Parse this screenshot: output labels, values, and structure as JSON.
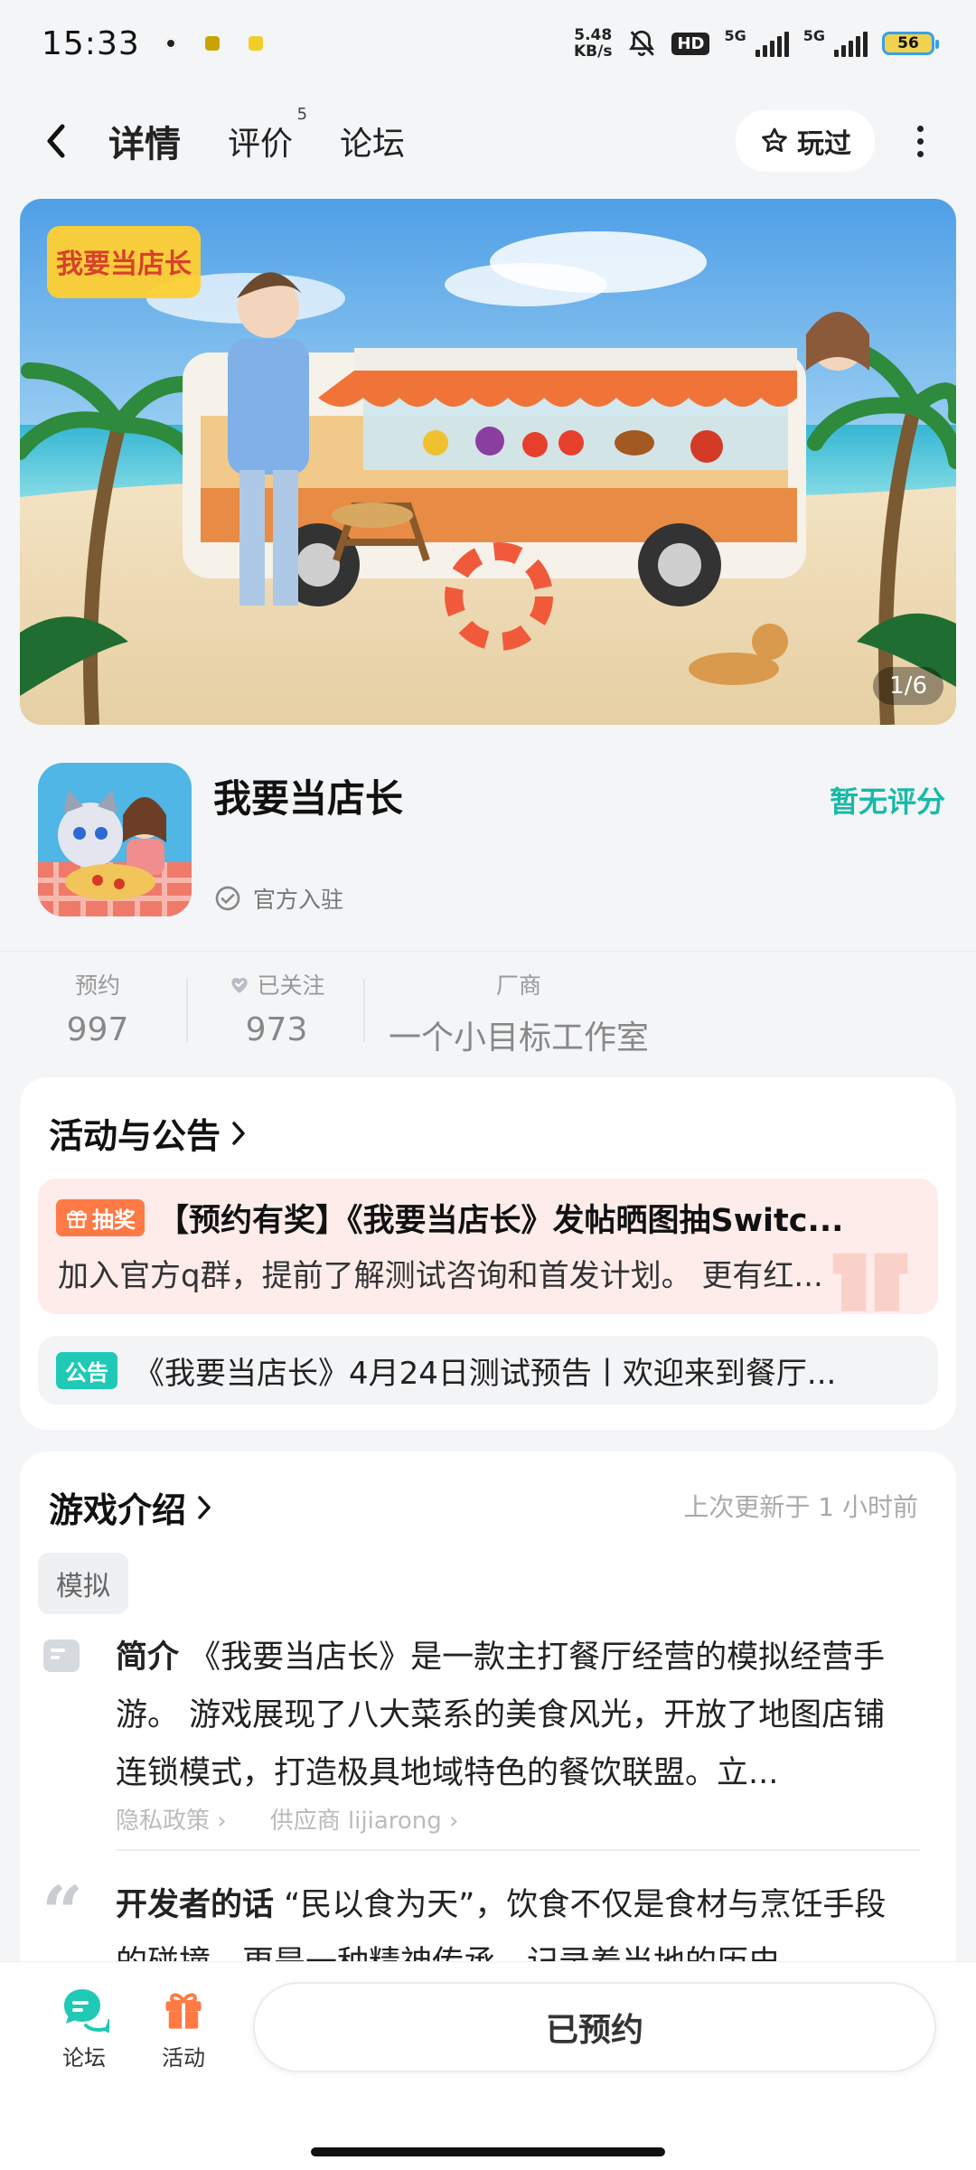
{
  "status_bar": {
    "time": "15:33",
    "net_speed_value": "5.48",
    "net_speed_unit": "KB/s",
    "hd": "HD",
    "sig1": "5G",
    "sig2": "5G",
    "battery": "56"
  },
  "nav": {
    "tabs": [
      {
        "label": "详情",
        "active": true
      },
      {
        "label": "评价",
        "badge": "5"
      },
      {
        "label": "论坛"
      }
    ],
    "played_label": "玩过"
  },
  "banner": {
    "counter": "1/6",
    "logo_text": "我要当店长"
  },
  "app": {
    "title": "我要当店长",
    "official": "官方入驻",
    "rating": "暂无评分"
  },
  "stats": [
    {
      "label": "预约",
      "value": "997"
    },
    {
      "label": "已关注",
      "value": "973"
    },
    {
      "label": "厂商",
      "value": "一个小目标工作室"
    }
  ],
  "activities": {
    "title": "活动与公告",
    "lottery_tag": "抽奖",
    "lottery_title": "【预约有奖】《我要当店长》发帖晒图抽Switc...",
    "lottery_desc": "加入官方q群，提前了解测试咨询和首发计划。 更有红...",
    "notice_tag": "公告",
    "notice_text": "《我要当店长》4月24日测试预告丨欢迎来到餐厅..."
  },
  "intro": {
    "title": "游戏介绍",
    "updated": "上次更新于 1 小时前",
    "genre": "模拟",
    "summary_label": "简介",
    "summary": "《我要当店长》是一款主打餐厅经营的模拟经营手游。 游戏展现了八大菜系的美食风光，开放了地图店铺连锁模式，打造极具地域特色的餐饮联盟。立...",
    "privacy": "隐私政策",
    "supplier": "供应商 lijiarong",
    "dev_label": "开发者的话",
    "dev_text": "“民以食为天”，饮食不仅是食材与烹饪手段的碰撞，更是一种精神传承，记录着当地的历史"
  },
  "bottom": {
    "forum": "论坛",
    "activity": "活动",
    "reserved": "已预约"
  },
  "colors": {
    "accent": "#19b9a7",
    "tab_highlight": "#2fd3c0",
    "lottery_tag": "#ff7a45",
    "notice_tag": "#1fc9b5"
  }
}
